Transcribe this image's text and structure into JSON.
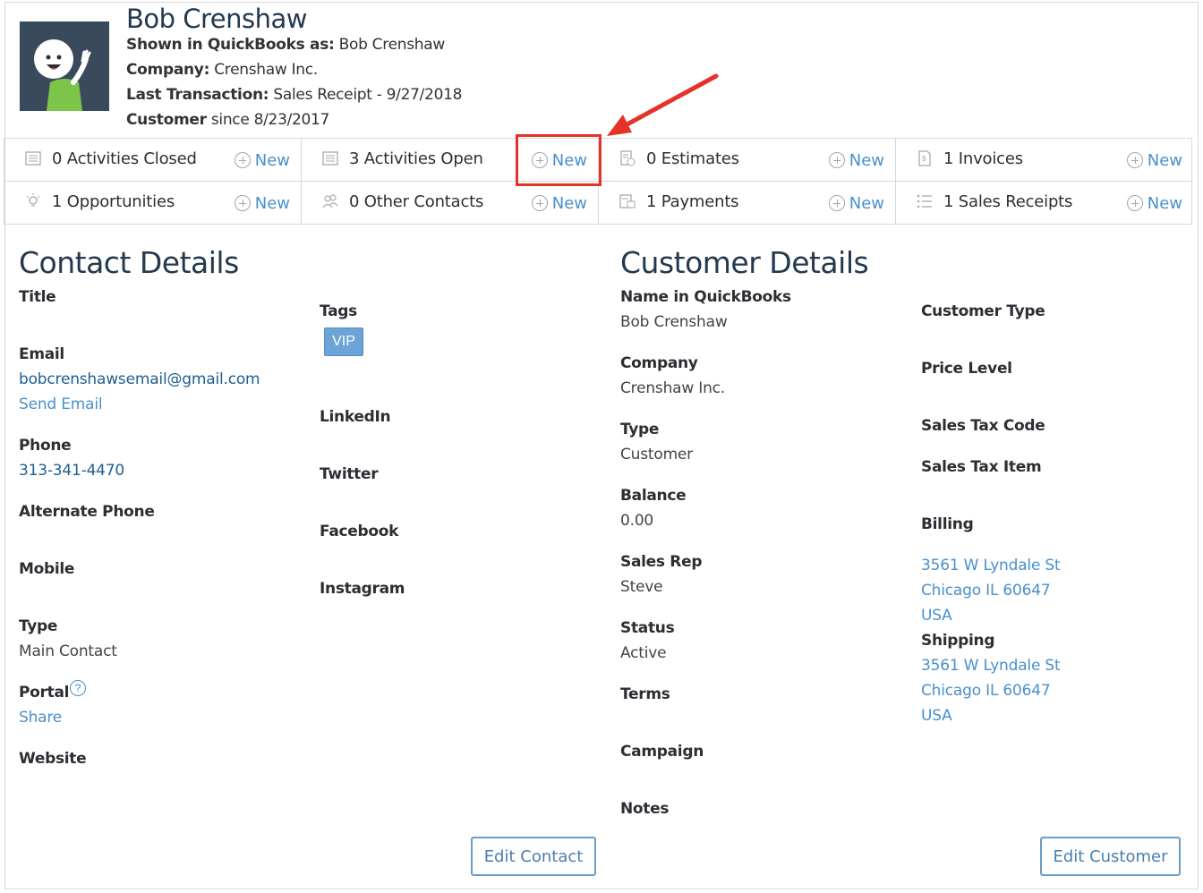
{
  "header": {
    "name": "Bob Crenshaw",
    "shown_label": "Shown in QuickBooks as:",
    "shown_value": "Bob Crenshaw",
    "company_label": "Company:",
    "company_value": "Crenshaw Inc.",
    "last_label": "Last Transaction:",
    "last_value": "Sales Receipt - 9/27/2018",
    "customer_label": "Customer",
    "customer_value": "since 8/23/2017"
  },
  "summary": [
    {
      "icon": "list-icon",
      "label": "0 Activities Closed",
      "new": "New"
    },
    {
      "icon": "list-icon",
      "label": "3 Activities Open",
      "new": "New"
    },
    {
      "icon": "estimate-icon",
      "label": "0 Estimates",
      "new": "New"
    },
    {
      "icon": "invoice-icon",
      "label": "1 Invoices",
      "new": "New"
    },
    {
      "icon": "lightbulb-icon",
      "label": "1 Opportunities",
      "new": "New"
    },
    {
      "icon": "contacts-icon",
      "label": "0 Other Contacts",
      "new": "New"
    },
    {
      "icon": "payment-icon",
      "label": "1 Payments",
      "new": "New"
    },
    {
      "icon": "receipt-list-icon",
      "label": "1 Sales Receipts",
      "new": "New"
    }
  ],
  "contact": {
    "heading": "Contact Details",
    "title_label": "Title",
    "email_label": "Email",
    "email": "bobcrenshawsemail@gmail.com",
    "send_email": "Send Email",
    "phone_label": "Phone",
    "phone": "313-341-4470",
    "alt_phone_label": "Alternate Phone",
    "mobile_label": "Mobile",
    "type_label": "Type",
    "type_value": "Main Contact",
    "portal_label": "Portal",
    "help_glyph": "?",
    "share": "Share",
    "website_label": "Website",
    "tags_label": "Tags",
    "tag": "VIP",
    "linkedin_label": "LinkedIn",
    "twitter_label": "Twitter",
    "facebook_label": "Facebook",
    "instagram_label": "Instagram",
    "edit_button": "Edit Contact"
  },
  "customer": {
    "heading": "Customer Details",
    "name_label": "Name in QuickBooks",
    "name_value": "Bob Crenshaw",
    "company_label": "Company",
    "company_value": "Crenshaw Inc.",
    "type_label": "Type",
    "type_value": "Customer",
    "balance_label": "Balance",
    "balance_value": "0.00",
    "rep_label": "Sales Rep",
    "rep_value": "Steve",
    "status_label": "Status",
    "status_value": "Active",
    "terms_label": "Terms",
    "campaign_label": "Campaign",
    "notes_label": "Notes",
    "customer_type_label": "Customer Type",
    "price_level_label": "Price Level",
    "tax_code_label": "Sales Tax Code",
    "tax_item_label": "Sales Tax Item",
    "billing_label": "Billing",
    "billing": [
      "3561 W Lyndale St",
      "Chicago IL 60647",
      "USA"
    ],
    "shipping_label": "Shipping",
    "shipping": [
      "3561 W Lyndale St",
      "Chicago IL 60647",
      "USA"
    ],
    "edit_button": "Edit Customer"
  },
  "colors": {
    "accent": "#4a90c9",
    "annotation": "#e5332a",
    "heading": "#24394e"
  }
}
